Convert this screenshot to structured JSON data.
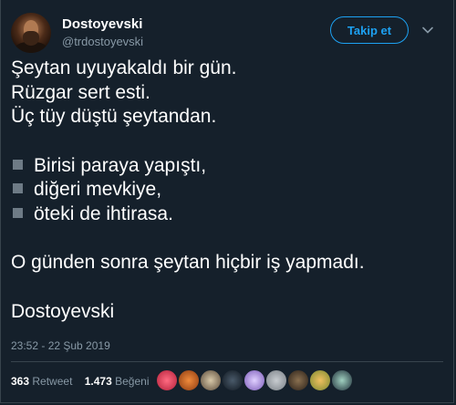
{
  "author": {
    "name": "Dostoyevski",
    "handle": "@trdostoyevski"
  },
  "follow_label": "Takip et",
  "tweet": {
    "lines": [
      "Şeytan uyuyakaldı bir gün.",
      "Rüzgar sert esti.",
      "Üç tüy düştü şeytandan."
    ],
    "bullets": [
      "Birisi paraya yapıştı,",
      "diğeri mevkiye,",
      "öteki de ihtirasa."
    ],
    "closing": "O günden sonra şeytan hiçbir iş yapmadı.",
    "signature": "Dostoyevski"
  },
  "timestamp": "23:52 - 22 Şub 2019",
  "stats": {
    "retweets_count": "363",
    "retweets_label": "Retweet",
    "likes_count": "1.473",
    "likes_label": "Beğeni"
  },
  "colors": {
    "background": "#15202b",
    "accent": "#1da1f2",
    "muted": "#8899a6"
  },
  "icons": [
    "chevron-down-icon",
    "bullet-square-icon"
  ]
}
